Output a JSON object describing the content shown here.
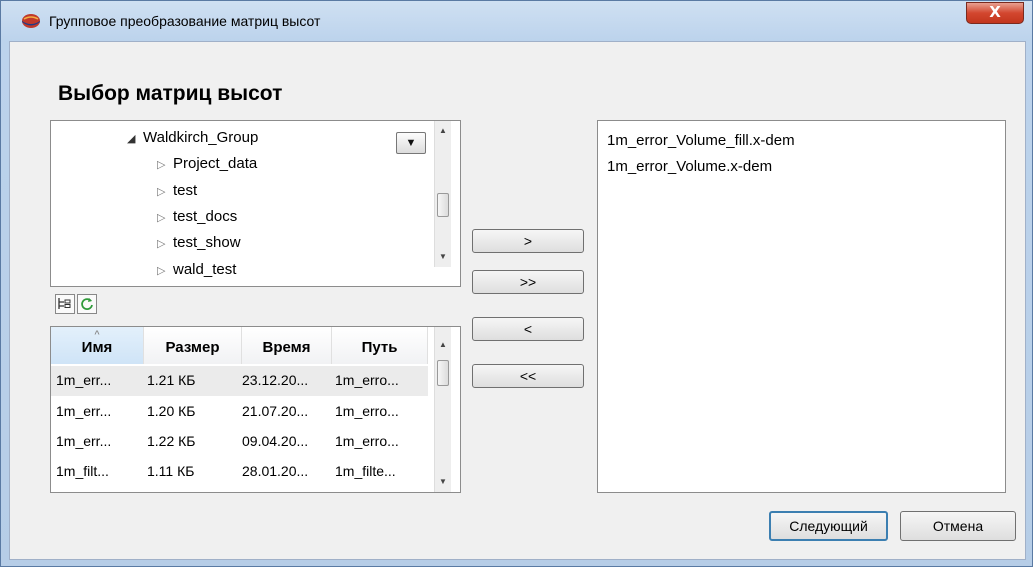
{
  "window": {
    "title": "Групповое преобразование матриц высот",
    "close_label": "X"
  },
  "heading": "Выбор матриц высот",
  "tree": {
    "root": "Waldkirch_Group",
    "children": [
      "Project_data",
      "test",
      "test_docs",
      "test_show",
      "wald_test"
    ]
  },
  "table": {
    "columns": [
      "Имя",
      "Размер",
      "Время",
      "Путь"
    ],
    "rows": [
      [
        "1m_err...",
        "1.21 КБ",
        "23.12.20...",
        "1m_erro..."
      ],
      [
        "1m_err...",
        "1.20 КБ",
        "21.07.20...",
        "1m_erro..."
      ],
      [
        "1m_err...",
        "1.22 КБ",
        "09.04.20...",
        "1m_erro..."
      ],
      [
        "1m_filt...",
        "1.11 КБ",
        "28.01.20...",
        "1m_filte..."
      ]
    ]
  },
  "transfer_buttons": {
    "add": ">",
    "add_all": ">>",
    "remove": "<",
    "remove_all": "<<"
  },
  "selected_files": [
    "1m_error_Volume_fill.x-dem",
    "1m_error_Volume.x-dem"
  ],
  "footer": {
    "next_label": "Следующий",
    "cancel_label": "Отмена"
  },
  "colors": {
    "accent": "#3c7fb1",
    "close": "#d3472f",
    "refresh": "#2f9a3a"
  }
}
